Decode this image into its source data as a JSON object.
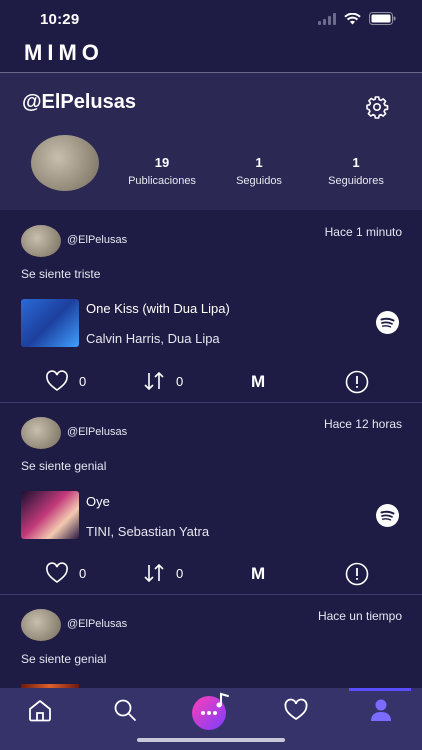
{
  "status": {
    "time": "10:29"
  },
  "app": {
    "brand": "MIMO"
  },
  "profile": {
    "username": "@ElPelusas",
    "stats": [
      {
        "value": "19",
        "label": "Publicaciones"
      },
      {
        "value": "1",
        "label": "Seguidos"
      },
      {
        "value": "1",
        "label": "Seguidores"
      }
    ]
  },
  "posts": [
    {
      "user": "@ElPelusas",
      "time": "Hace 1 minuto",
      "mood": "Se siente triste",
      "song": "One Kiss (with Dua Lipa)",
      "artist": "Calvin Harris, Dua Lipa",
      "likes": "0",
      "shares": "0",
      "m_label": "M"
    },
    {
      "user": "@ElPelusas",
      "time": "Hace 12 horas",
      "mood": "Se siente genial",
      "song": "Oye",
      "artist": "TINI, Sebastian Yatra",
      "likes": "0",
      "shares": "0",
      "m_label": "M"
    },
    {
      "user": "@ElPelusas",
      "time": "Hace un tiempo",
      "mood": "Se siente genial"
    }
  ],
  "tabbar": {
    "items": [
      "home-icon",
      "search-icon",
      "music-center-icon",
      "heart-icon",
      "profile-icon"
    ],
    "active": "profile-icon"
  },
  "colors": {
    "background": "#1e1c44",
    "profile_panel": "#2b2954",
    "tabbar": "#35336a",
    "active_tab": "#7b6cff",
    "center_button": "#d83ad0"
  }
}
